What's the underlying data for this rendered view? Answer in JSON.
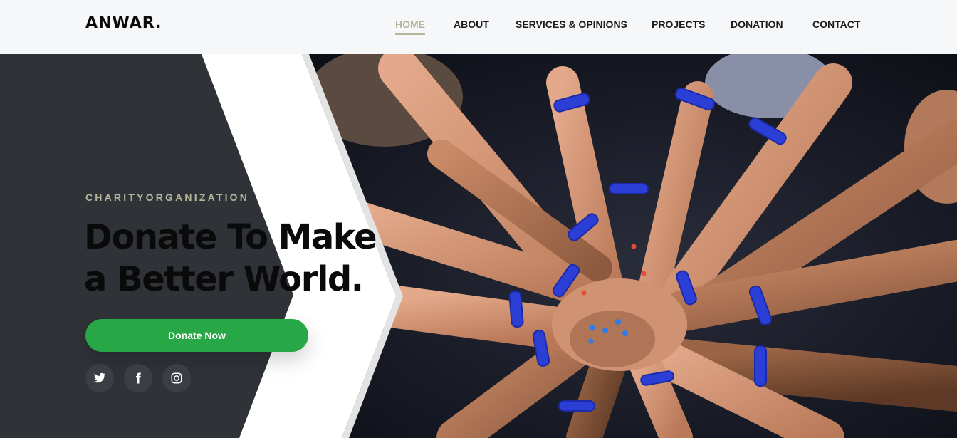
{
  "header": {
    "brand": "ANWAR.",
    "nav": [
      {
        "label": "HOME",
        "active": true
      },
      {
        "label": "ABOUT",
        "active": false
      },
      {
        "label": "SERVICES & OPINIONS",
        "active": false
      },
      {
        "label": "PROJECTS",
        "active": false
      },
      {
        "label": "DONATION",
        "active": false
      },
      {
        "label": "CONTACT",
        "active": false
      }
    ]
  },
  "hero": {
    "eyebrow": "CHARITYORGANIZATION",
    "headline": [
      "Donate To Make",
      "a Better World."
    ],
    "cta_label": "Donate Now",
    "socials": [
      "twitter-icon",
      "facebook-icon",
      "instagram-icon"
    ],
    "image": "hands-stacked-with-blue-wristbands"
  },
  "colors": {
    "accent": "#b5b69a",
    "cta": "#27a745",
    "dark_panel": "#2f3237",
    "navbar_bg": "#f6f7f9"
  }
}
